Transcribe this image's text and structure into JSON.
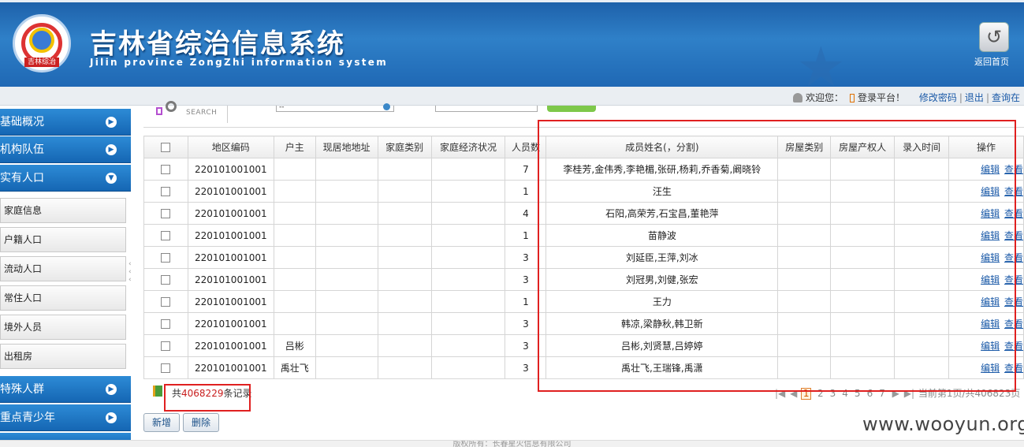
{
  "header": {
    "logo_text": "吉林综治",
    "title": "吉林省综治信息系统",
    "subtitle": "Jilin province ZongZhi information system",
    "home_label": "返回首页"
  },
  "userbar": {
    "welcome": "欢迎您：",
    "platform": "登录平台！",
    "change_password": "修改密码",
    "logout": "退出",
    "query": "查询在"
  },
  "sidebar": {
    "sections": [
      {
        "label": "基础概况",
        "icon": "chevron-right-icon"
      },
      {
        "label": "机构队伍",
        "icon": "chevron-right-icon"
      },
      {
        "label": "实有人口",
        "icon": "chevron-down-icon"
      }
    ],
    "sub_items": [
      "家庭信息",
      "户籍人口",
      "流动人口",
      "常住人口",
      "境外人员",
      "出租房"
    ],
    "sections_bottom": [
      {
        "label": "特殊人群",
        "icon": "chevron-right-icon"
      },
      {
        "label": "重点青少年",
        "icon": "chevron-right-icon"
      }
    ]
  },
  "search": {
    "label": "SEARCH",
    "select_value": "--"
  },
  "table": {
    "columns": [
      "",
      "地区编码",
      "户主",
      "现居地地址",
      "家庭类别",
      "家庭经济状况",
      "人员数",
      "成员姓名(，分割)",
      "房屋类别",
      "房屋产权人",
      "录入时间",
      "操作"
    ],
    "rows": [
      {
        "code": "220101001001",
        "head": "",
        "address": "",
        "family_type": "",
        "economy": "",
        "count": "7",
        "members": "李桂芳,金伟秀,李艳楣,张研,杨莉,乔香菊,阚晓铃",
        "house_type": "",
        "owner": "",
        "time": ""
      },
      {
        "code": "220101001001",
        "head": "",
        "address": "",
        "family_type": "",
        "economy": "",
        "count": "1",
        "members": "汪生",
        "house_type": "",
        "owner": "",
        "time": ""
      },
      {
        "code": "220101001001",
        "head": "",
        "address": "",
        "family_type": "",
        "economy": "",
        "count": "4",
        "members": "石阳,高荣芳,石宝昌,董艳萍",
        "house_type": "",
        "owner": "",
        "time": ""
      },
      {
        "code": "220101001001",
        "head": "",
        "address": "",
        "family_type": "",
        "economy": "",
        "count": "1",
        "members": "苗静波",
        "house_type": "",
        "owner": "",
        "time": ""
      },
      {
        "code": "220101001001",
        "head": "",
        "address": "",
        "family_type": "",
        "economy": "",
        "count": "3",
        "members": "刘延臣,王萍,刘冰",
        "house_type": "",
        "owner": "",
        "time": ""
      },
      {
        "code": "220101001001",
        "head": "",
        "address": "",
        "family_type": "",
        "economy": "",
        "count": "3",
        "members": "刘冠男,刘健,张宏",
        "house_type": "",
        "owner": "",
        "time": ""
      },
      {
        "code": "220101001001",
        "head": "",
        "address": "",
        "family_type": "",
        "economy": "",
        "count": "1",
        "members": "王力",
        "house_type": "",
        "owner": "",
        "time": ""
      },
      {
        "code": "220101001001",
        "head": "",
        "address": "",
        "family_type": "",
        "economy": "",
        "count": "3",
        "members": "韩凉,梁静秋,韩卫新",
        "house_type": "",
        "owner": "",
        "time": ""
      },
      {
        "code": "220101001001",
        "head": "吕彬",
        "address": "",
        "family_type": "",
        "economy": "",
        "count": "3",
        "members": "吕彬,刘贤慧,吕婷婷",
        "house_type": "",
        "owner": "",
        "time": ""
      },
      {
        "code": "220101001001",
        "head": "禹壮飞",
        "address": "",
        "family_type": "",
        "economy": "",
        "count": "3",
        "members": "禹壮飞,王瑞锋,禹潇",
        "house_type": "",
        "owner": "",
        "time": ""
      }
    ],
    "edit_label": "编辑",
    "view_label": "查看"
  },
  "footer": {
    "total_prefix": "共",
    "total_count": "4068229",
    "total_suffix": "条记录",
    "pages": [
      "1",
      "2",
      "3",
      "4",
      "5",
      "6",
      "7"
    ],
    "current_page": "1",
    "page_info": "当前第1页/共406823页"
  },
  "actions": {
    "add": "新增",
    "delete": "删除"
  },
  "watermark": "www.wooyun.org",
  "bottom_text": "版权所有：长春星火信息有限公司",
  "colors": {
    "header_blue": "#2f80c8",
    "menu_blue": "#1d74c4",
    "highlight_red": "#e02020",
    "link_blue": "#1b5aa8"
  }
}
